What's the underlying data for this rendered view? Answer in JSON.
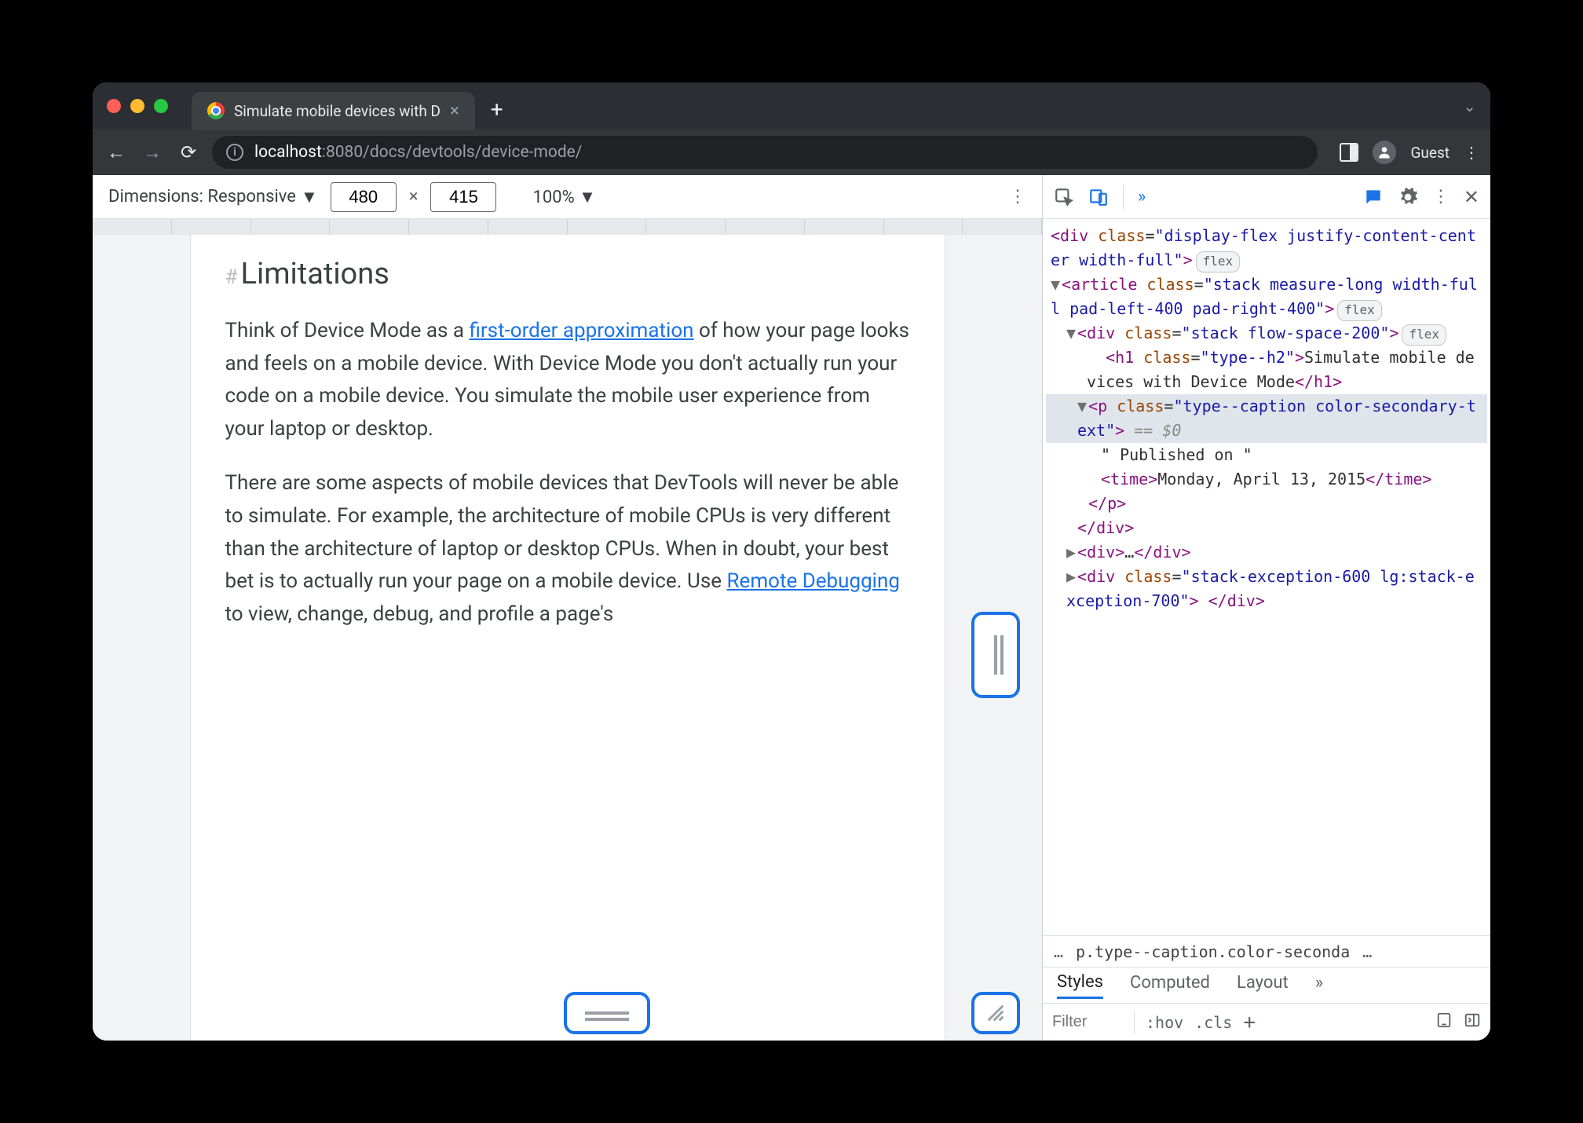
{
  "window": {
    "tab_title": "Simulate mobile devices with D",
    "user_label": "Guest"
  },
  "url": {
    "host": "localhost",
    "port": ":8080",
    "path": "/docs/devtools/device-mode/"
  },
  "device_bar": {
    "dimensions_label": "Dimensions: Responsive",
    "width": "480",
    "height": "415",
    "zoom": "100%"
  },
  "article": {
    "heading": "Limitations",
    "p1_pre": "Think of Device Mode as a ",
    "p1_link": "first-order approximation",
    "p1_post": " of how your page looks and feels on a mobile device. With Device Mode you don't actually run your code on a mobile device. You simulate the mobile user experience from your laptop or desktop.",
    "p2_pre": "There are some aspects of mobile devices that DevTools will never be able to simulate. For example, the architecture of mobile CPUs is very different than the architecture of laptop or desktop CPUs. When in doubt, your best bet is to actually run your page on a mobile device. Use ",
    "p2_link": "Remote Debugging",
    "p2_post": " to view, change, debug, and profile a page's"
  },
  "elements": {
    "l1": "<div class=\"display-flex justify-content-center width-full\">",
    "l1_pill": "flex",
    "l2": "<article class=\"stack measure-long width-full pad-left-400 pad-right-400\">",
    "l2_pill": "flex",
    "l3": "<div class=\"stack flow-space-200\">",
    "l3_pill": "flex",
    "l4": "<h1 class=\"type--h2\">Simulate mobile devices with Device Mode</h1>",
    "l5": "<p class=\"type--caption color-secondary-text\">",
    "l5_var": " == $0",
    "l6": "\" Published on \"",
    "l7": "<time>Monday, April 13, 2015</time>",
    "l8": "</p>",
    "l9": "</div>",
    "l10": "<div>…</div>",
    "l11": "<div class=\"stack-exception-600 lg:stack-exception-700\"> </div>"
  },
  "breadcrumb": {
    "ell1": "…",
    "sel": "p.type--caption.color-seconda",
    "ell2": "…"
  },
  "styles": {
    "tab1": "Styles",
    "tab2": "Computed",
    "tab3": "Layout",
    "filter_placeholder": "Filter",
    "hov": ":hov",
    "cls": ".cls"
  }
}
